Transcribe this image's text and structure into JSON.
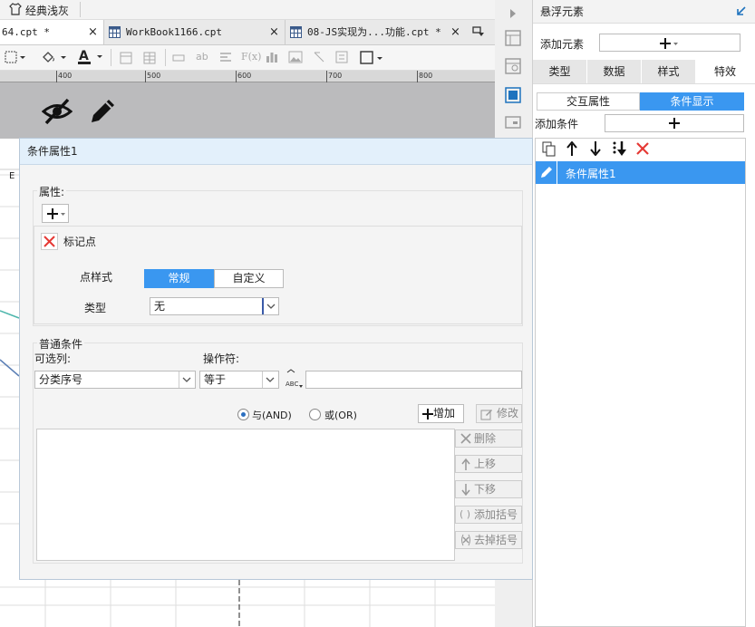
{
  "theme": {
    "label": "经典浅灰"
  },
  "tabs": [
    {
      "label": "64.cpt *",
      "close": "×"
    },
    {
      "label": "WorkBook1166.cpt",
      "close": "×"
    },
    {
      "label": "08-JS实现为...功能.cpt *",
      "close": "×"
    }
  ],
  "ruler": {
    "ticks": [
      "400",
      "500",
      "600",
      "700",
      "800"
    ]
  },
  "sheet": {
    "col_header": "E"
  },
  "dialog": {
    "title": "条件属性1",
    "attr_section": "属性:",
    "marker_label": "标记点",
    "point_style_label": "点样式",
    "seg_normal": "常规",
    "seg_custom": "自定义",
    "type_label": "类型",
    "type_value": "无",
    "common_condition": "普通条件",
    "optional_col_label": "可选列:",
    "optional_col_value": "分类序号",
    "operator_label": "操作符:",
    "operator_value": "等于",
    "value_input": "",
    "and_label": "与(AND)",
    "or_label": "或(OR)",
    "add_btn": "增加",
    "modify_btn": "修改",
    "delete_btn": "删除",
    "up_btn": "上移",
    "down_btn": "下移",
    "add_bracket_btn": "添加括号",
    "remove_bracket_btn": "去掉括号"
  },
  "right_panel": {
    "title": "悬浮元素",
    "add_element_label": "添加元素",
    "tabs": [
      "类型",
      "数据",
      "样式",
      "特效"
    ],
    "active_tab": "特效",
    "subtabs": [
      "交互属性",
      "条件显示"
    ],
    "add_condition_label": "添加条件",
    "list_items": [
      "条件属性1"
    ]
  },
  "colors": {
    "accent": "#3a97f0",
    "delete_red": "#e53935",
    "title_bg": "#e3f0fb"
  }
}
